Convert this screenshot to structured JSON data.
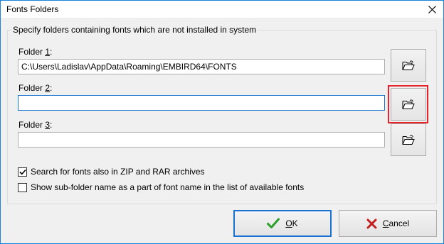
{
  "window": {
    "title": "Fonts Folders"
  },
  "group": {
    "legend": "Specify folders containing fonts which are not installed in system"
  },
  "folders": [
    {
      "label": "Folder ",
      "num": "1",
      "suffix": ":",
      "value": "C:\\Users\\Ladislav\\AppData\\Roaming\\EMBIRD64\\FONTS"
    },
    {
      "label": "Folder ",
      "num": "2",
      "suffix": ":",
      "value": ""
    },
    {
      "label": "Folder ",
      "num": "3",
      "suffix": ":",
      "value": ""
    }
  ],
  "options": {
    "search_zip": {
      "label": "Search for fonts also in ZIP and RAR archives",
      "checked": true
    },
    "show_subfolder": {
      "label": "Show sub-folder name as a part of font name in the list of available fonts",
      "checked": false
    }
  },
  "buttons": {
    "ok": {
      "label_key": "O",
      "label_rest": "K",
      "icon": "check-icon"
    },
    "cancel": {
      "label_key": "C",
      "label_rest": "ancel",
      "icon": "x-icon"
    }
  },
  "colors": {
    "highlight": "#e8222a",
    "focus": "#1a73d2",
    "ok_green": "#2a9d2a",
    "cancel_red": "#c41e1e"
  },
  "icons": {
    "browse": "open-folder-icon",
    "close": "close-icon"
  }
}
